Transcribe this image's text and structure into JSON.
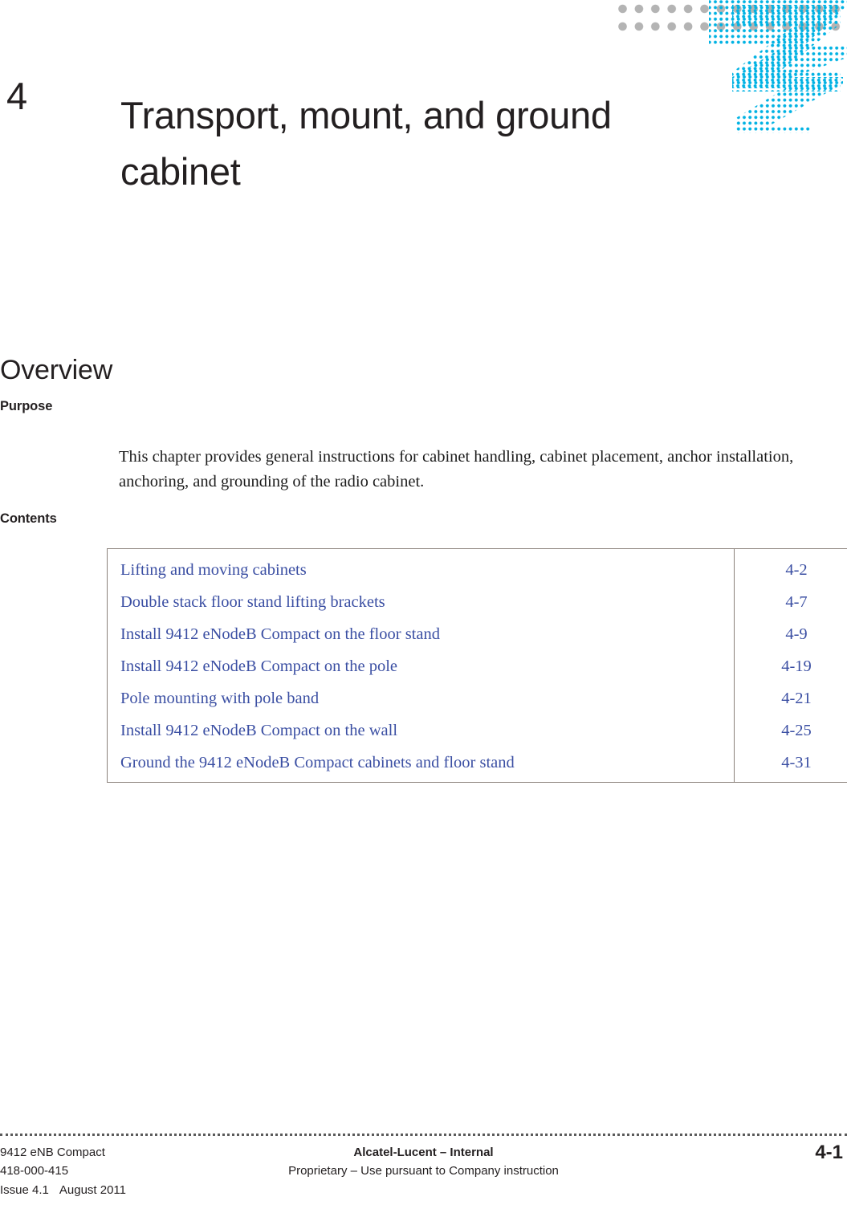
{
  "page": {
    "chapter_number": "4",
    "chapter_title": "Transport, mount, and ground cabinet",
    "overview_heading": "Overview"
  },
  "sections": {
    "purpose": {
      "label": "Purpose",
      "body": "This chapter provides general instructions for cabinet handling, cabinet placement, anchor installation, anchoring, and grounding of the radio cabinet."
    },
    "contents": {
      "label": "Contents",
      "rows": [
        {
          "title": "Lifting and moving cabinets",
          "page": "4-2"
        },
        {
          "title": "Double stack floor stand lifting brackets",
          "page": "4-7"
        },
        {
          "title": "Install 9412 eNodeB Compact on the floor stand",
          "page": "4-9"
        },
        {
          "title": "Install 9412 eNodeB Compact on the pole",
          "page": "4-19"
        },
        {
          "title": "Pole mounting with pole band",
          "page": "4-21"
        },
        {
          "title": "Install 9412 eNodeB Compact on the wall",
          "page": "4-25"
        },
        {
          "title": "Ground the 9412 eNodeB Compact cabinets and floor stand",
          "page": "4-31"
        }
      ]
    }
  },
  "footer": {
    "product": "9412 eNB Compact",
    "doc_number": "418-000-415",
    "issue": "Issue 4.1",
    "date": "August 2011",
    "classification": "Alcatel-Lucent – Internal",
    "proprietary": "Proprietary – Use pursuant to Company instruction",
    "page_number": "4-1"
  },
  "decoration": {
    "logo_name": "alcatel-lucent-dotted-arrow-logo",
    "dot_band_name": "header-dot-band",
    "accent_color": "#00b2e3",
    "band_dot_color": "#b4b4b4",
    "toc_link_color": "#3b4fa3",
    "table_border_color": "#8a817a"
  }
}
